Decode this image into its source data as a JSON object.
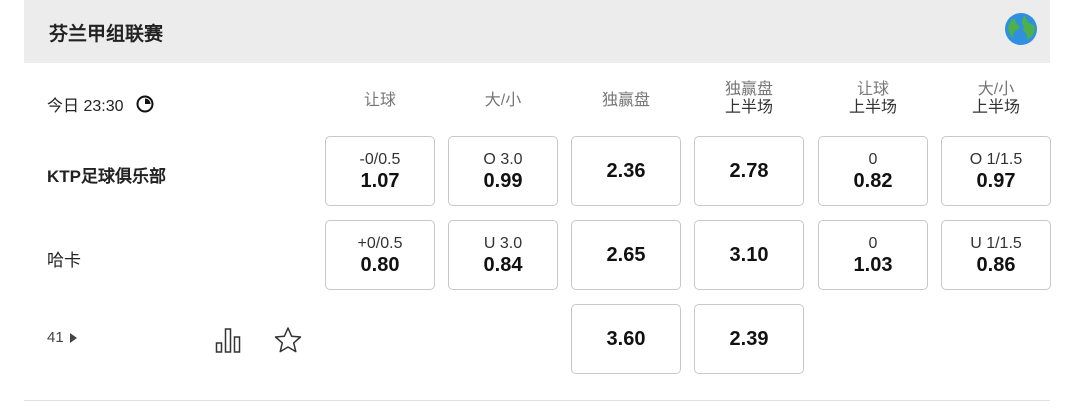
{
  "league": {
    "title": "芬兰甲组联赛"
  },
  "match": {
    "time": "今日 23:30",
    "more_markets": "41"
  },
  "columns": [
    {
      "line1": "让球",
      "line2": ""
    },
    {
      "line1": "大/小",
      "line2": ""
    },
    {
      "line1": "独赢盘",
      "line2": ""
    },
    {
      "line1": "独赢盘",
      "line2": "上半场"
    },
    {
      "line1": "让球",
      "line2": "上半场"
    },
    {
      "line1": "大/小",
      "line2": "上半场"
    }
  ],
  "teams": {
    "home": "KTP足球俱乐部",
    "away": "哈卡"
  },
  "odds": {
    "home": [
      {
        "line": "-0/0.5",
        "value": "1.07"
      },
      {
        "line": "O 3.0",
        "value": "0.99"
      },
      {
        "line": "",
        "value": "2.36"
      },
      {
        "line": "",
        "value": "2.78"
      },
      {
        "line": "0",
        "value": "0.82"
      },
      {
        "line": "O 1/1.5",
        "value": "0.97"
      }
    ],
    "away": [
      {
        "line": "+0/0.5",
        "value": "0.80"
      },
      {
        "line": "U 3.0",
        "value": "0.84"
      },
      {
        "line": "",
        "value": "2.65"
      },
      {
        "line": "",
        "value": "3.10"
      },
      {
        "line": "0",
        "value": "1.03"
      },
      {
        "line": "U 1/1.5",
        "value": "0.86"
      }
    ],
    "draw": [
      {
        "value": "3.60"
      },
      {
        "value": "2.39"
      }
    ]
  },
  "icons": {
    "globe": "globe-icon",
    "clock": "clock-icon",
    "stats": "bar-chart-icon",
    "favorite": "star-icon",
    "more": "caret-right-icon"
  }
}
